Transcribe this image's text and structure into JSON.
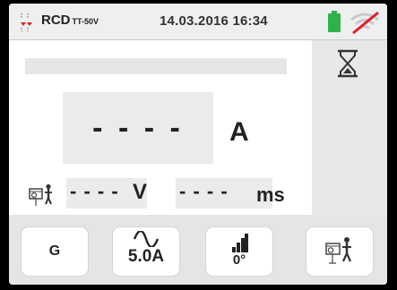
{
  "header": {
    "title": "RCD",
    "title_sub": "TT-50V",
    "datetime": "14.03.2016  16:34",
    "icons": {
      "mode": "rcd-icon",
      "battery": "battery-icon",
      "wifi": "wifi-off-icon"
    }
  },
  "main": {
    "current_value": "- - - -",
    "current_unit": "A",
    "voltage_value": "- - - -",
    "voltage_unit": "V",
    "time_value": "- - - -",
    "time_unit": "ms",
    "status_icon": "hourglass-icon"
  },
  "buttons": {
    "type_label": "G",
    "current_label": "5.0A",
    "phase_label": "0°",
    "earth_icon": "earth-probe-icon"
  },
  "colors": {
    "battery_green": "#2fb24a",
    "wifi_strike_red": "#e01f2a"
  }
}
